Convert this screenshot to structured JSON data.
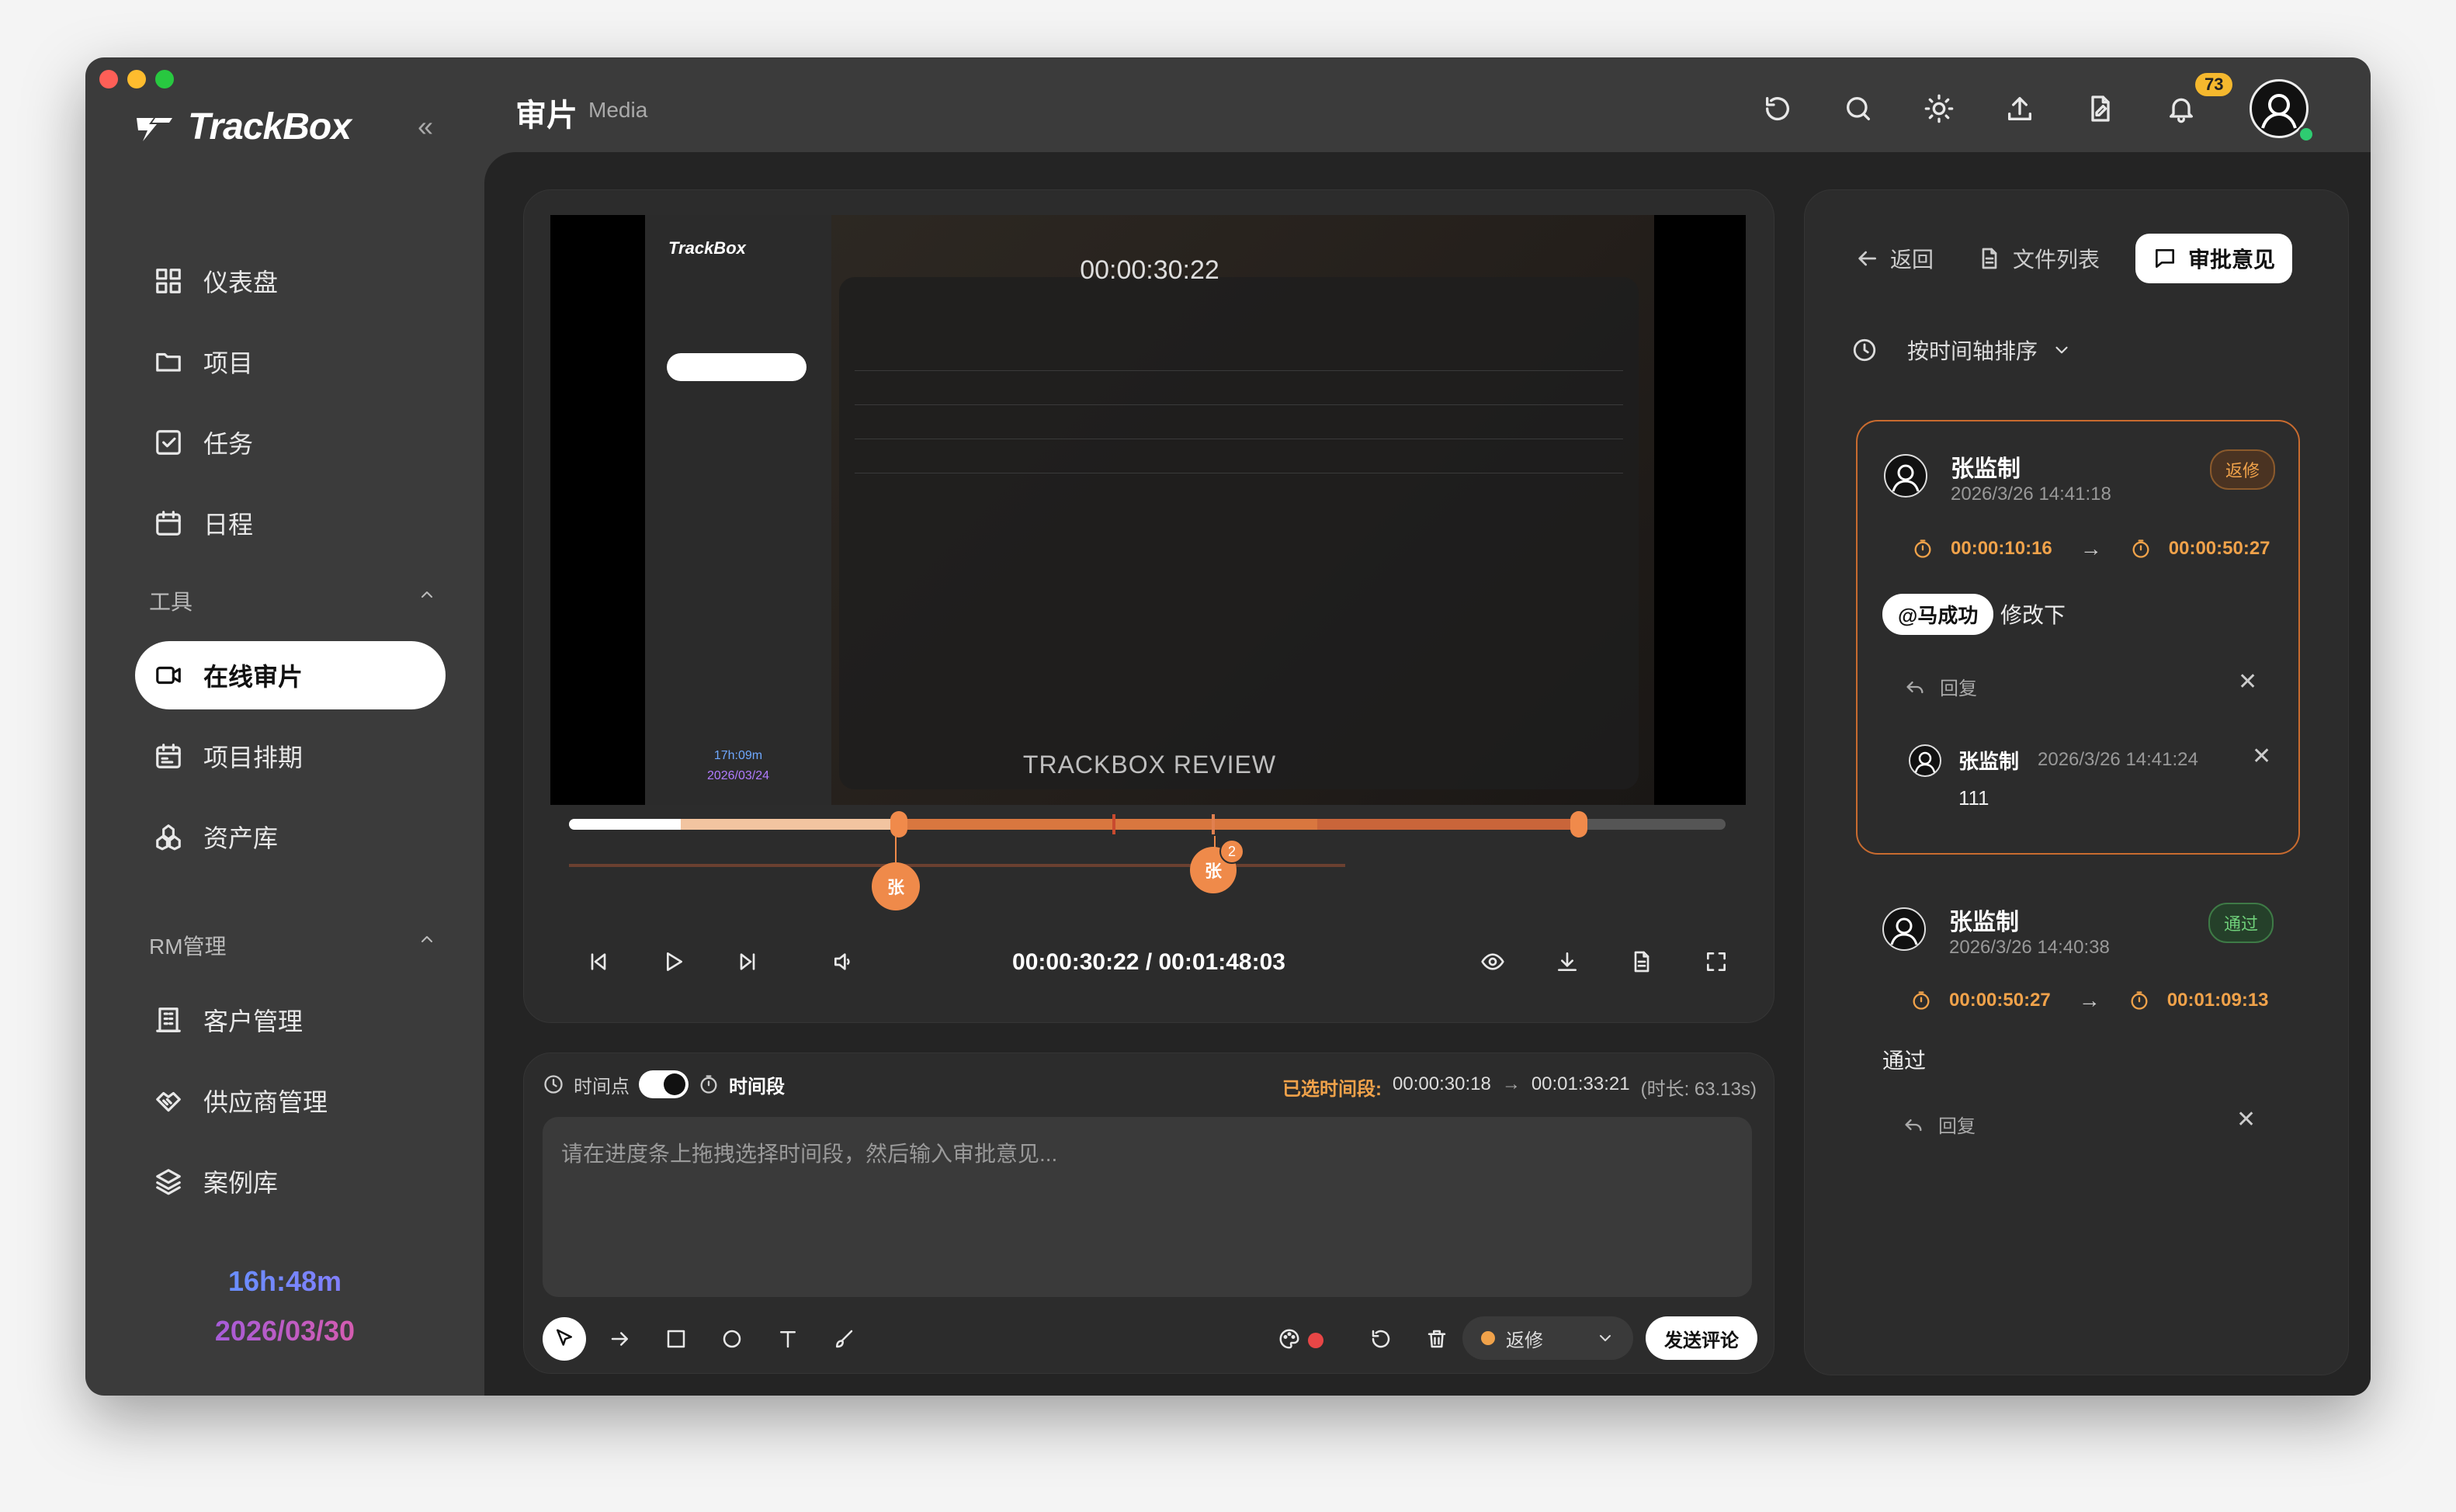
{
  "app": {
    "name": "TrackBox",
    "collapse_symbol": "«"
  },
  "sidebar": {
    "nav": [
      {
        "label": "仪表盘",
        "icon": "dashboard-icon"
      },
      {
        "label": "项目",
        "icon": "folder-icon"
      },
      {
        "label": "任务",
        "icon": "task-icon"
      },
      {
        "label": "日程",
        "icon": "calendar-icon"
      }
    ],
    "tools_group": "工具",
    "tools": [
      {
        "label": "在线审片",
        "icon": "video-icon",
        "active": true
      },
      {
        "label": "项目排期",
        "icon": "schedule-icon"
      },
      {
        "label": "资产库",
        "icon": "assets-icon"
      }
    ],
    "rm_group": "RM管理",
    "rm": [
      {
        "label": "客户管理",
        "icon": "building-icon"
      },
      {
        "label": "供应商管理",
        "icon": "handshake-icon"
      },
      {
        "label": "案例库",
        "icon": "layers-icon"
      }
    ],
    "clock_time": "16h:48m",
    "clock_date": "2026/03/30"
  },
  "header": {
    "title": "审片",
    "subtitle": "Media",
    "notification_count": "73"
  },
  "player": {
    "overlay_time": "00:00:30:22",
    "watermark": "TRACKBOX REVIEW",
    "current_time": "00:00:30:22",
    "separator": " / ",
    "total_time": "00:01:48:03",
    "pin_label": "张",
    "pin_count": "2",
    "inner_clock_time": "17h:09m",
    "inner_clock_date": "2026/03/24"
  },
  "composer": {
    "mode_point": "时间点",
    "mode_range": "时间段",
    "selected_label": "已选时间段:",
    "selected_start": "00:00:30:18",
    "arrow": "→",
    "selected_end": "00:01:33:21",
    "duration": "(时长: 63.13s)",
    "placeholder": "请在进度条上拖拽选择时间段，然后输入审批意见...",
    "status_value": "返修",
    "send_label": "发送评论"
  },
  "review_panel": {
    "back_label": "返回",
    "files_label": "文件列表",
    "comments_label": "审批意见",
    "sort_label": "按时间轴排序",
    "comments": [
      {
        "author": "张监制",
        "date": "2026/3/26 14:41:18",
        "status": "返修",
        "start": "00:00:10:16",
        "end": "00:00:50:27",
        "mention": "@马成功",
        "text": "修改下",
        "reply_label": "回复",
        "replies": [
          {
            "author": "张监制",
            "date": "2026/3/26 14:41:24",
            "text": "111"
          }
        ]
      },
      {
        "author": "张监制",
        "date": "2026/3/26 14:40:38",
        "status": "通过",
        "start": "00:00:50:27",
        "end": "00:01:09:13",
        "text": "通过",
        "reply_label": "回复"
      }
    ]
  },
  "colors": {
    "accent_orange": "#ef8a4a",
    "rework": "#f0a24a",
    "pass": "#6fd07a"
  }
}
